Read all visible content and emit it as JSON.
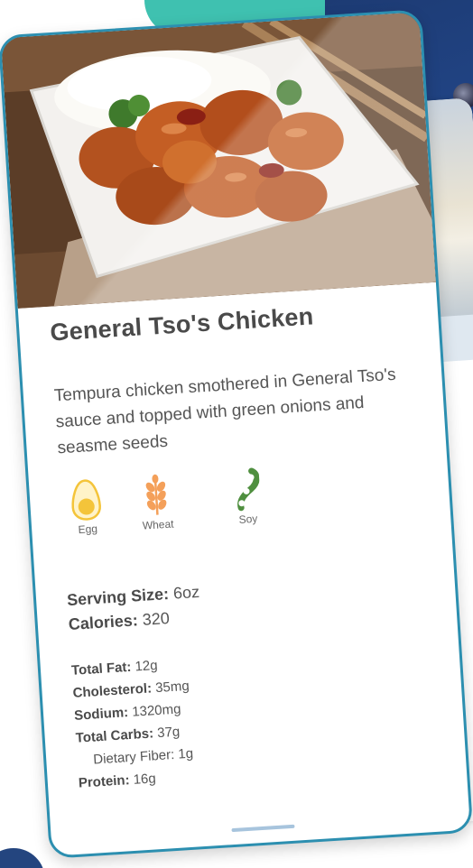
{
  "dish": {
    "title": "General Tso's Chicken",
    "description": "Tempura chicken smothered in General Tso's sauce and topped with green onions and seasme seeds"
  },
  "allergens": [
    {
      "label": "Egg",
      "icon": "egg-icon",
      "color": "#f4c43a"
    },
    {
      "label": "Wheat",
      "icon": "wheat-icon",
      "color": "#f4a05a"
    },
    {
      "label": "Soy",
      "icon": "soy-icon",
      "color": "#4f8f3f"
    }
  ],
  "serving": {
    "size_label": "Serving Size:",
    "size_value": " 6oz",
    "calories_label": "Calories:",
    "calories_value": " 320"
  },
  "nutrition": {
    "fat_label": "Total Fat:",
    "fat_value": " 12g",
    "cholesterol_label": "Cholesterol:",
    "cholesterol_value": " 35mg",
    "sodium_label": "Sodium:",
    "sodium_value": " 1320mg",
    "carbs_label": "Total Carbs:",
    "carbs_value": " 37g",
    "fiber_label": "Dietary Fiber:",
    "fiber_value": " 1g",
    "protein_label": "Protein:",
    "protein_value": " 16g"
  },
  "colors": {
    "card_border": "#2c8fb0",
    "accent_teal": "#3fc1b0",
    "navy": "#1d3b74"
  }
}
